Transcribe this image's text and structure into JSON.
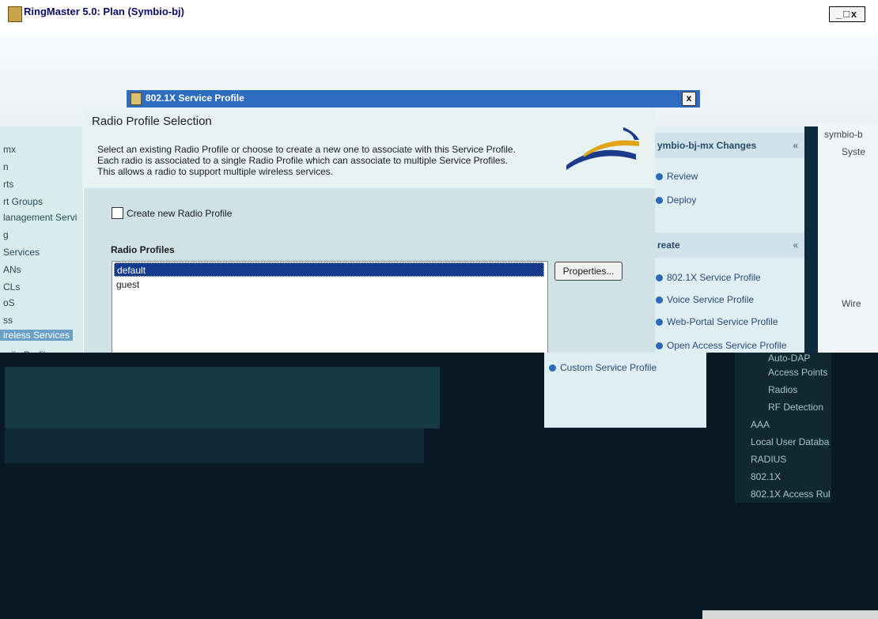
{
  "window": {
    "title": "RingMaster 5.0: Plan (Symbio-bj)",
    "controls": "_□x"
  },
  "left_tree": {
    "items": [
      "mx",
      "n",
      "rts",
      "rt Groups",
      "lanagement Servi",
      "g",
      "Services",
      "ANs",
      "CLs",
      "oS",
      "ss",
      "ireless Services",
      "adio Profiles"
    ]
  },
  "tasks_panel": {
    "changes_header": "ymbio-bj-mx Changes",
    "changes_items": [
      "Review",
      "Deploy"
    ],
    "create_header": "reate",
    "create_items": [
      "802.1X Service Profile",
      "Voice Service Profile",
      "Web-Portal Service Profile",
      "Open Access Service Profile",
      "Custom Service Profile"
    ]
  },
  "right_tree": {
    "items": [
      "symbio-b",
      "Syste",
      "Wire"
    ],
    "lower_items": [
      "Auto-DAP",
      "Access Points",
      "Radios",
      "RF Detection",
      "AAA",
      "Local User Databa",
      "RADIUS",
      "802.1X",
      "802.1X Access Rul"
    ]
  },
  "dialog": {
    "title": "802.1X Service Profile",
    "close": "x",
    "heading": "Radio Profile Selection",
    "description": [
      "Select an existing Radio Profile or choose to create a new one to associate with this Service Profile.",
      "Each radio is associated to a single Radio Profile which can associate to multiple Service Profiles.",
      "This allows a radio to support multiple wireless services."
    ],
    "create_new_label": "Create new Radio Profile",
    "create_new_checked": false,
    "radio_profiles_label": "Radio Profiles",
    "radio_profiles": [
      "default",
      "guest"
    ],
    "selected_profile": "default",
    "properties_button": "Properties..."
  },
  "colors": {
    "dialog_title_bar": "#2e6cc0",
    "selection": "#143a8c",
    "task_link": "#2a6ab8",
    "logo_blue": "#1b3a8a",
    "logo_gold": "#e0a416"
  }
}
